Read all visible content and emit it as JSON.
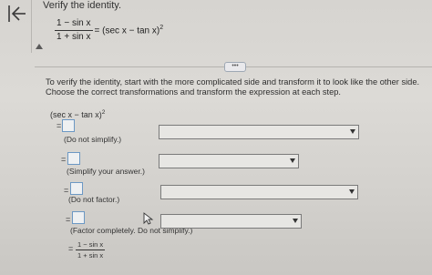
{
  "instruction": "Verify the identity.",
  "identity": {
    "numerator": "1 − sin x",
    "denominator": "1 + sin x",
    "rhs": "= (sec x − tan x)",
    "exponent": "2"
  },
  "more_button": "•••",
  "explanation": "To verify the identity, start with the more complicated side and transform it to look like the other side. Choose the correct transformations and transform the expression at each step.",
  "start_expression": {
    "text": "(sec x − tan x)",
    "exponent": "2"
  },
  "steps": [
    {
      "equals": "=",
      "hint": "(Do not simplify.)",
      "selected": ""
    },
    {
      "equals": "=",
      "hint": "(Simplify your answer.)",
      "selected": ""
    },
    {
      "equals": "=",
      "hint": "(Do not factor.)",
      "selected": ""
    },
    {
      "equals": "=",
      "hint": "(Factor completely. Do not simplify.)",
      "selected": ""
    }
  ],
  "final": {
    "equals": "=",
    "numerator": "1 − sin x",
    "denominator": "1 + sin x"
  },
  "colors": {
    "answer_box_border": "#6c98c4",
    "dropdown_border": "#7a7a7a"
  }
}
